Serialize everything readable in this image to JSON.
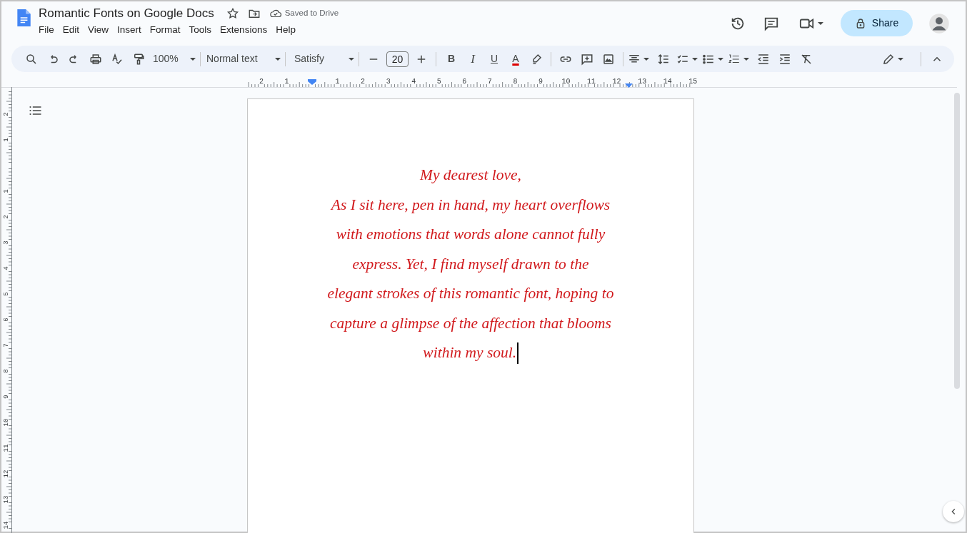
{
  "header": {
    "title": "Romantic Fonts on Google Docs",
    "save_status": "Saved to Drive",
    "menus": [
      "File",
      "Edit",
      "View",
      "Insert",
      "Format",
      "Tools",
      "Extensions",
      "Help"
    ],
    "share": "Share"
  },
  "toolbar": {
    "zoom": "100%",
    "paragraph_style": "Normal text",
    "font": "Satisfy",
    "font_size": "20",
    "format_letters": [
      "B",
      "I",
      "U",
      "A"
    ]
  },
  "ruler": {
    "horizontal": [
      "2",
      "1",
      "1",
      "2",
      "3",
      "4",
      "5",
      "6",
      "7",
      "8",
      "9",
      "10",
      "11",
      "12",
      "13",
      "14",
      "15"
    ],
    "vertical": [
      "2",
      "1",
      "1",
      "2",
      "3",
      "4",
      "5",
      "6",
      "7",
      "8",
      "9",
      "10",
      "11",
      "12",
      "13",
      "14"
    ]
  },
  "page": {
    "lines": [
      "My dearest love,",
      "As I sit here, pen in hand, my heart overflows",
      "with emotions that words alone cannot fully",
      "express. Yet, I find myself drawn to the",
      "elegant strokes of this romantic font, hoping to",
      "capture a glimpse of the affection that blooms",
      "within my soul."
    ],
    "caret_at_end": true
  }
}
